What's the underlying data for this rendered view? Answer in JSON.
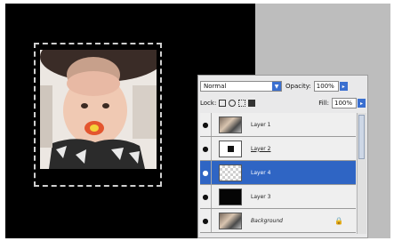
{
  "layers_panel": {
    "blend_mode": "Normal",
    "opacity_label": "Opacity:",
    "opacity_value": "100%",
    "lock_label": "Lock:",
    "fill_label": "Fill:",
    "fill_value": "100%",
    "layers": [
      {
        "name": "Layer 1",
        "visible": true,
        "thumb": "photo",
        "selected": false
      },
      {
        "name": "Layer 2",
        "visible": true,
        "thumb": "mask",
        "selected": false
      },
      {
        "name": "Layer 4",
        "visible": true,
        "thumb": "transparent",
        "selected": true
      },
      {
        "name": "Layer 3",
        "visible": true,
        "thumb": "black",
        "selected": false
      },
      {
        "name": "Background",
        "visible": true,
        "thumb": "photo",
        "selected": false,
        "locked": true
      }
    ]
  },
  "colors": {
    "document_bg": "#000000",
    "selection_highlight": "#2f65c4",
    "panel_bg": "#e9e9ea"
  }
}
